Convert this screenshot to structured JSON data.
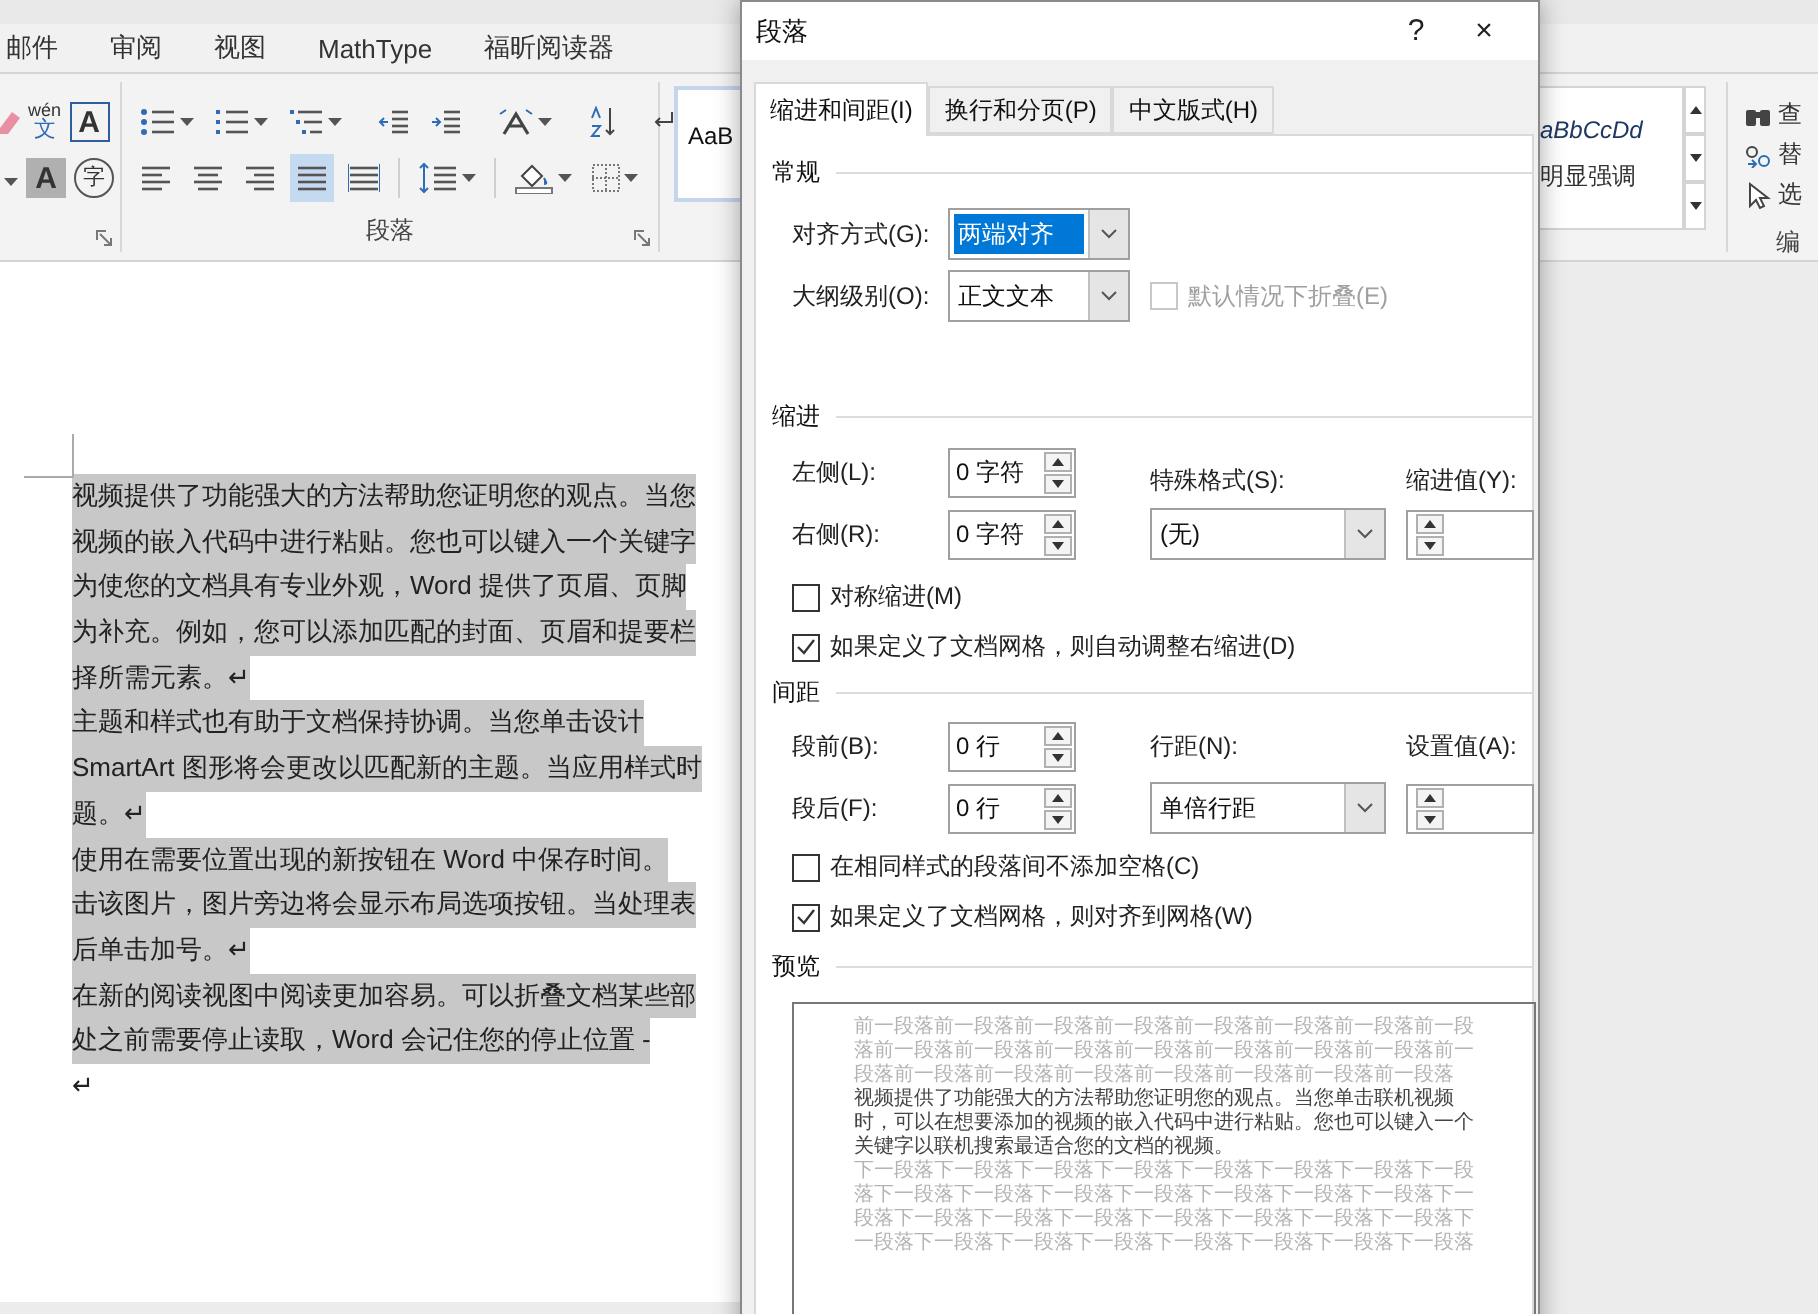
{
  "ribbon_tabs": [
    {
      "label": "邮件"
    },
    {
      "label": "审阅"
    },
    {
      "label": "视图"
    },
    {
      "label": "MathType"
    },
    {
      "label": "福昕阅读器"
    }
  ],
  "font_group": {
    "phonetic": "wén",
    "phonetic_sub": "文",
    "bordered": "A",
    "shaded": "A",
    "enclosed": "字"
  },
  "paragraph_group": {
    "label": "段落",
    "alignment": [
      {
        "kind": "left",
        "selected": false
      },
      {
        "kind": "center",
        "selected": false
      },
      {
        "kind": "right",
        "selected": false
      },
      {
        "kind": "justify",
        "selected": true
      },
      {
        "kind": "distributed",
        "selected": false
      }
    ]
  },
  "styles": {
    "left_sample": "AaB",
    "right_sample": "aBbCcDd",
    "right_name": "明显强调"
  },
  "editing": {
    "items": [
      {
        "kind": "find",
        "label": "查"
      },
      {
        "kind": "replace",
        "label": "替"
      },
      {
        "kind": "select",
        "label": "选"
      }
    ],
    "label": "编"
  },
  "document": {
    "lines": [
      {
        "text": "视频提供了功能强大的方法帮助您证明您的观点。当您",
        "highlighted": true
      },
      {
        "text": "视频的嵌入代码中进行粘贴。您也可以键入一个关键字",
        "highlighted": true
      },
      {
        "text": "为使您的文档具有专业外观，Word 提供了页眉、页脚",
        "highlighted": true
      },
      {
        "text": "为补充。例如，您可以添加匹配的封面、页眉和提要栏",
        "highlighted": true
      },
      {
        "text": "择所需元素。↵",
        "highlighted": true
      },
      {
        "text": "主题和样式也有助于文档保持协调。当您单击设计",
        "highlighted": true
      },
      {
        "text": "SmartArt 图形将会更改以匹配新的主题。当应用样式时",
        "highlighted": true
      },
      {
        "text": "题。↵",
        "highlighted": true
      },
      {
        "text": "使用在需要位置出现的新按钮在 Word 中保存时间。",
        "highlighted": true
      },
      {
        "text": "击该图片，图片旁边将会显示布局选项按钮。当处理表",
        "highlighted": true
      },
      {
        "text": "后单击加号。↵",
        "highlighted": true
      },
      {
        "text": "在新的阅读视图中阅读更加容易。可以折叠文档某些部",
        "highlighted": true
      },
      {
        "text": "处之前需要停止读取，Word 会记住您的停止位置 -",
        "highlighted": true
      },
      {
        "text": "↵",
        "highlighted": false
      }
    ]
  },
  "dialog": {
    "title": "段落",
    "help": "?",
    "close": "×",
    "tabs": [
      {
        "label": "缩进和间距(I)",
        "selected": true
      },
      {
        "label": "换行和分页(P)",
        "selected": false
      },
      {
        "label": "中文版式(H)",
        "selected": false
      }
    ],
    "general": {
      "heading": "常规",
      "alignment": {
        "label": "对齐方式(G):",
        "value": "两端对齐",
        "focused": true
      },
      "outline": {
        "label": "大纲级别(O):",
        "value": "正文文本",
        "focused": false
      },
      "collapse": {
        "label": "默认情况下折叠(E)",
        "checked": false,
        "disabled": true
      }
    },
    "indent": {
      "heading": "缩进",
      "left": {
        "label": "左侧(L):",
        "value": "0 字符"
      },
      "right": {
        "label": "右侧(R):",
        "value": "0 字符"
      },
      "special": {
        "label": "特殊格式(S):",
        "value": "(无)"
      },
      "by": {
        "label": "缩进值(Y):"
      },
      "mirror": {
        "label": "对称缩进(M)",
        "checked": false,
        "disabled": false
      },
      "auto_adjust": {
        "label": "如果定义了文档网格，则自动调整右缩进(D)",
        "checked": true,
        "disabled": false
      }
    },
    "spacing": {
      "heading": "间距",
      "before": {
        "label": "段前(B):",
        "value": "0 行"
      },
      "after": {
        "label": "段后(F):",
        "value": "0 行"
      },
      "line_spacing": {
        "label": "行距(N):",
        "value": "单倍行距"
      },
      "at": {
        "label": "设置值(A):"
      },
      "no_space": {
        "label": "在相同样式的段落间不添加空格(C)",
        "checked": false,
        "disabled": false
      },
      "snap": {
        "label": "如果定义了文档网格，则对齐到网格(W)",
        "checked": true,
        "disabled": false
      }
    },
    "preview": {
      "heading": "预览",
      "before_text": "前一段落前一段落前一段落前一段落前一段落前一段落前一段落前一段落前一段落前一段落前一段落前一段落前一段落前一段落前一段落前一段落前一段落前一段落前一段落前一段落前一段落前一段落前一段落",
      "sample_text": "视频提供了功能强大的方法帮助您证明您的观点。当您单击联机视频时，可以在想要添加的视频的嵌入代码中进行粘贴。您也可以键入一个关键字以联机搜索最适合您的文档的视频。",
      "after_text": "下一段落下一段落下一段落下一段落下一段落下一段落下一段落下一段落下一段落下一段落下一段落下一段落下一段落下一段落下一段落下一段落下一段落下一段落下一段落下一段落下一段落下一段落下一段落下一段落下一段落下一段落下一段落下一段落下一段落下一段落下一段落"
    }
  }
}
